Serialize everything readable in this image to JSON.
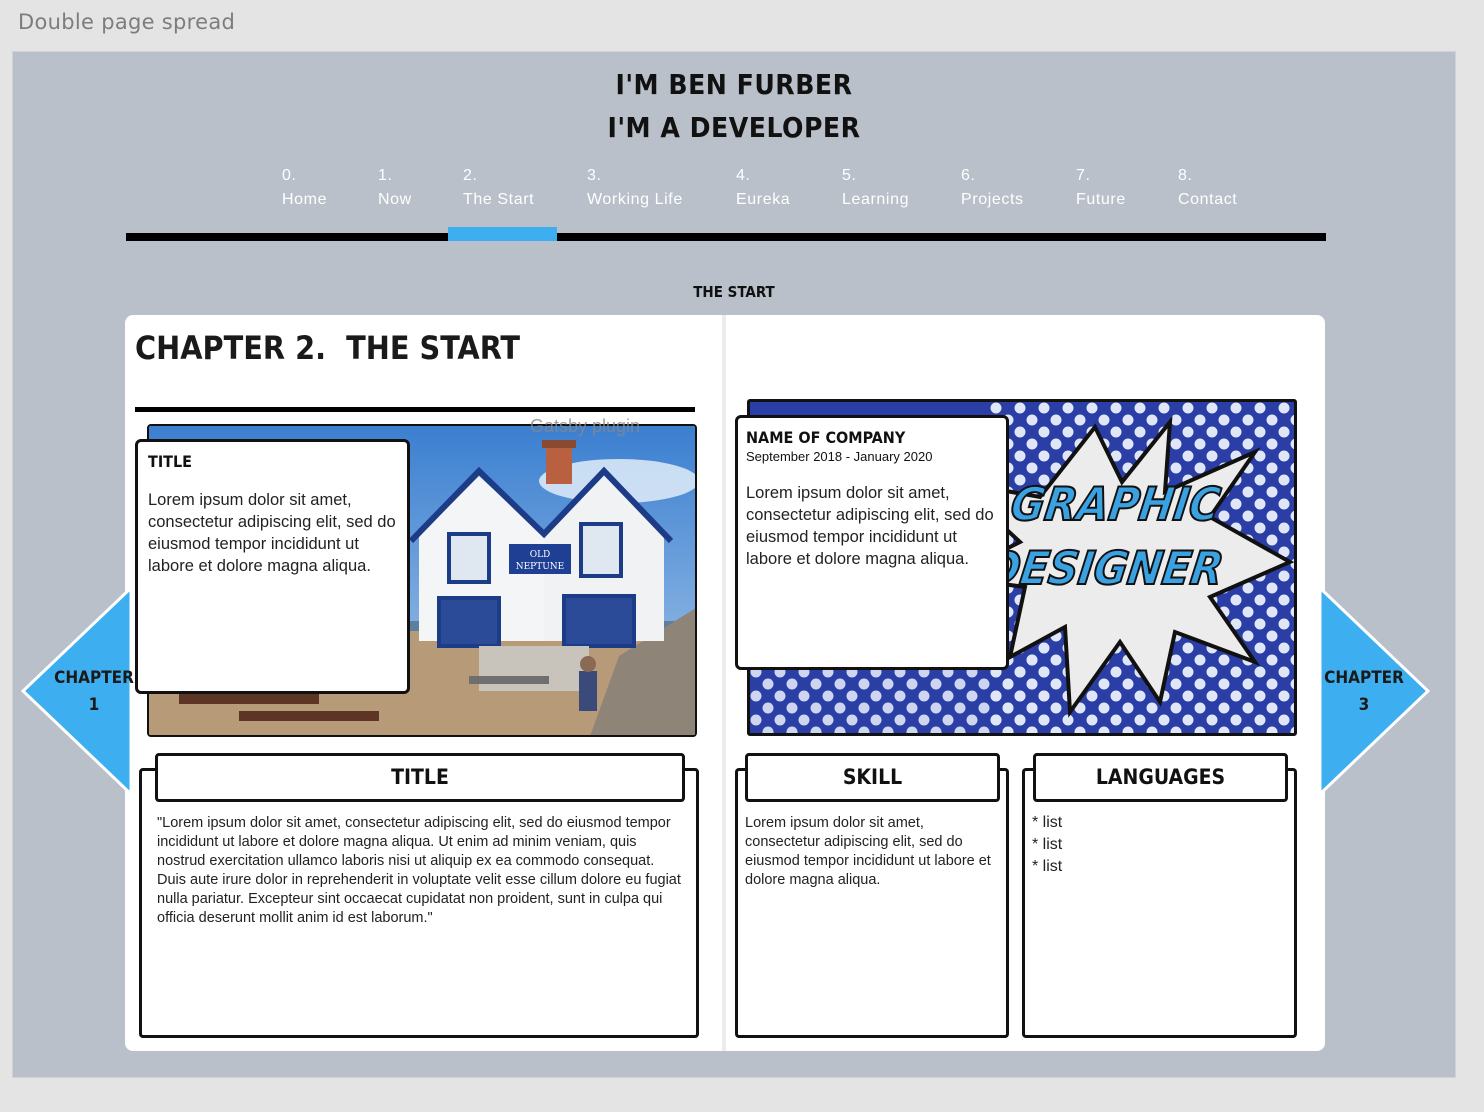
{
  "window": {
    "frame_label": "Double page spread"
  },
  "header": {
    "line1": "I'M BEN FURBER",
    "line2": "I'M A DEVELOPER"
  },
  "nav": {
    "items": [
      {
        "num": "0.",
        "label": "Home"
      },
      {
        "num": "1.",
        "label": "Now"
      },
      {
        "num": "2.",
        "label": "The Start"
      },
      {
        "num": "3.",
        "label": "Working Life"
      },
      {
        "num": "4.",
        "label": "Eureka"
      },
      {
        "num": "5.",
        "label": "Learning"
      },
      {
        "num": "6.",
        "label": "Projects"
      },
      {
        "num": "7.",
        "label": "Future"
      },
      {
        "num": "8.",
        "label": "Contact"
      }
    ],
    "active_index": 2
  },
  "section_label": "THE START",
  "left_page": {
    "chapter_title": "CHAPTER 2.  THE START",
    "photo_caption": "Gatsby plugin",
    "photo_sign": [
      "OLD",
      "NEPTUNE"
    ],
    "overlay": {
      "title": "TITLE",
      "body": "Lorem ipsum dolor sit amet, consectetur adipiscing elit, sed do eiusmod tempor incididunt ut labore et dolore magna aliqua."
    },
    "bottom": {
      "title": "TITLE",
      "body": "\"Lorem ipsum dolor sit amet, consectetur adipiscing elit, sed do eiusmod tempor incididunt ut labore et dolore magna aliqua. Ut enim ad minim veniam, quis nostrud exercitation ullamco laboris nisi ut aliquip ex ea commodo consequat. Duis aute irure dolor in reprehenderit in voluptate velit esse cillum dolore eu fugiat nulla pariatur. Excepteur sint occaecat cupidatat non proident, sunt in culpa qui officia deserunt mollit anim id est laborum.\""
    }
  },
  "right_page": {
    "comic_text": [
      "GRAPHIC",
      "DESIGNER"
    ],
    "overlay": {
      "company": "NAME OF COMPANY",
      "date": "September 2018 - January 2020",
      "body": "Lorem ipsum dolor sit amet, consectetur adipiscing elit, sed do eiusmod tempor incididunt ut labore et dolore magna aliqua."
    },
    "skill": {
      "title": "SKILL",
      "body": "Lorem ipsum dolor sit amet, consectetur adipiscing elit, sed do eiusmod tempor incididunt ut labore et dolore magna aliqua."
    },
    "languages": {
      "title": "LANGUAGES",
      "items": [
        "* list",
        "* list",
        "* list"
      ]
    }
  },
  "arrows": {
    "prev": {
      "line1": "CHAPTER",
      "line2": "1"
    },
    "next": {
      "line1": "CHAPTER",
      "line2": "3"
    }
  },
  "colors": {
    "accent": "#3daef0",
    "stage_bg": "#b9c0c9",
    "comic_bg": "#2a3ea6"
  }
}
